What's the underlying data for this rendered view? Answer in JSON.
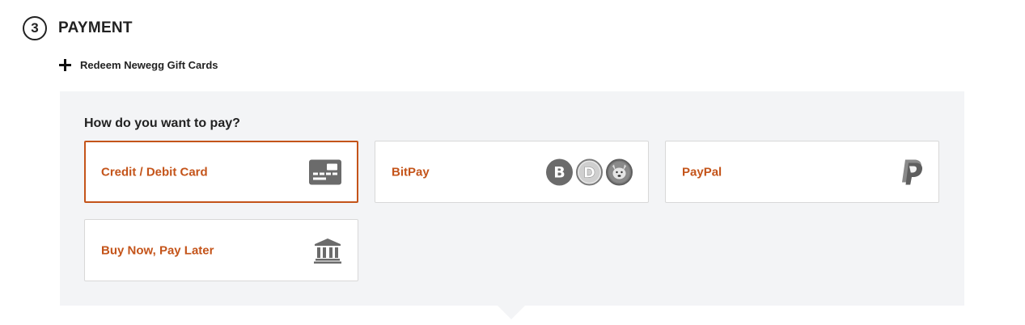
{
  "step": {
    "number": "3",
    "title": "PAYMENT"
  },
  "gift_card": {
    "label": "Redeem Newegg Gift Cards"
  },
  "payment": {
    "question": "How do you want to pay?",
    "options": [
      {
        "label": "Credit / Debit Card",
        "icon": "credit-card-icon",
        "selected": true
      },
      {
        "label": "BitPay",
        "icon": "crypto-coins-icon",
        "coins": [
          "B",
          "D",
          "SHIB"
        ],
        "selected": false
      },
      {
        "label": "PayPal",
        "icon": "paypal-icon",
        "selected": false
      },
      {
        "label": "Buy Now, Pay Later",
        "icon": "bank-icon",
        "selected": false
      }
    ]
  },
  "colors": {
    "accent": "#c4541a",
    "panel_bg": "#f3f4f6",
    "icon_gray": "#6b6b6b"
  }
}
